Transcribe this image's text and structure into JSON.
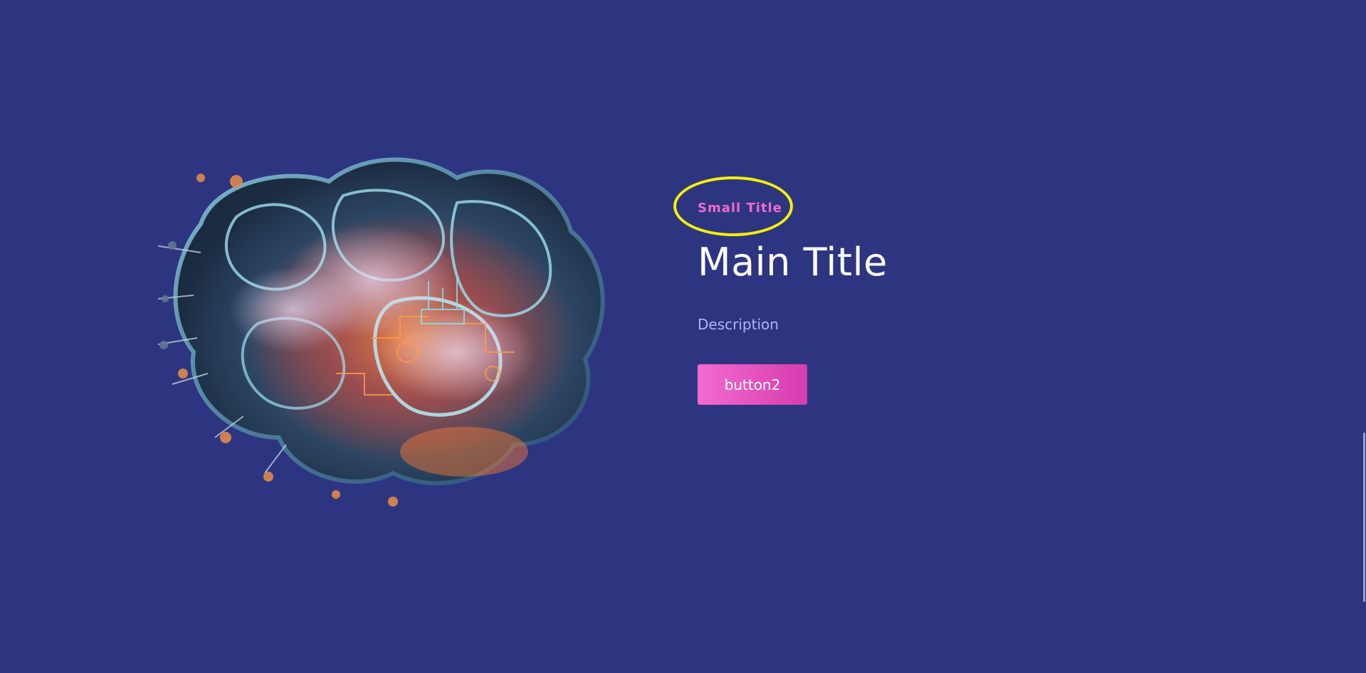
{
  "hero": {
    "image_name": "ai-brain-illustration",
    "small_title": "Small Title",
    "main_title": "Main Title",
    "description": "Description",
    "button_label": "button2"
  },
  "colors": {
    "background": "#2e3580",
    "accent": "#f06ad0",
    "highlight_ring": "#f4f00a",
    "description": "#a9b6ff",
    "title": "#ffffff"
  }
}
